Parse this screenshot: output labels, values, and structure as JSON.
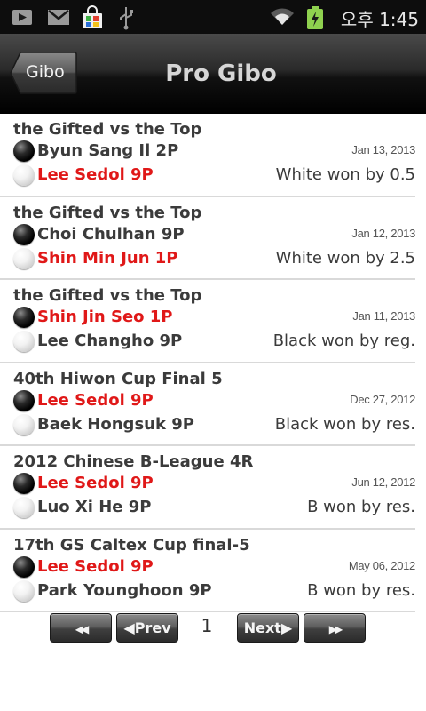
{
  "status_bar": {
    "time": "오후 1:45",
    "icons": [
      "play-store-icon",
      "gmail-icon",
      "market-bag-icon",
      "usb-icon",
      "wifi-icon",
      "battery-charging-icon"
    ]
  },
  "header": {
    "back_label": "Gibo",
    "title": "Pro Gibo"
  },
  "games": [
    {
      "title": "the Gifted vs the Top",
      "black": "Byun Sang Il 2P",
      "white": "Lee Sedol 9P",
      "winner": "white",
      "date": "Jan 13, 2013",
      "result": "White won by 0.5"
    },
    {
      "title": "the Gifted vs the Top",
      "black": "Choi Chulhan 9P",
      "white": "Shin Min Jun 1P",
      "winner": "white",
      "date": "Jan 12, 2013",
      "result": "White won by 2.5"
    },
    {
      "title": "the Gifted vs the Top",
      "black": "Shin Jin Seo 1P",
      "white": "Lee Changho 9P",
      "winner": "black",
      "date": "Jan 11, 2013",
      "result": "Black won by reg."
    },
    {
      "title": "40th Hiwon Cup Final 5",
      "black": "Lee Sedol 9P",
      "white": "Baek Hongsuk 9P",
      "winner": "black",
      "date": "Dec 27, 2012",
      "result": "Black won by res."
    },
    {
      "title": "2012 Chinese B-League 4R",
      "black": "Lee Sedol 9P",
      "white": "Luo Xi He 9P",
      "winner": "black",
      "date": "Jun 12, 2012",
      "result": "B won by res."
    },
    {
      "title": "17th GS Caltex Cup final-5",
      "black": "Lee Sedol 9P",
      "white": "Park Younghoon 9P",
      "winner": "black",
      "date": "May 06, 2012",
      "result": "B won by res."
    }
  ],
  "pager": {
    "first_label": "◀◀",
    "prev_label": "◀Prev",
    "page": "1",
    "next_label": "Next▶",
    "last_label": "▶▶"
  },
  "colors": {
    "winner_red": "#e01818",
    "text_dark": "#3b3b3b"
  }
}
